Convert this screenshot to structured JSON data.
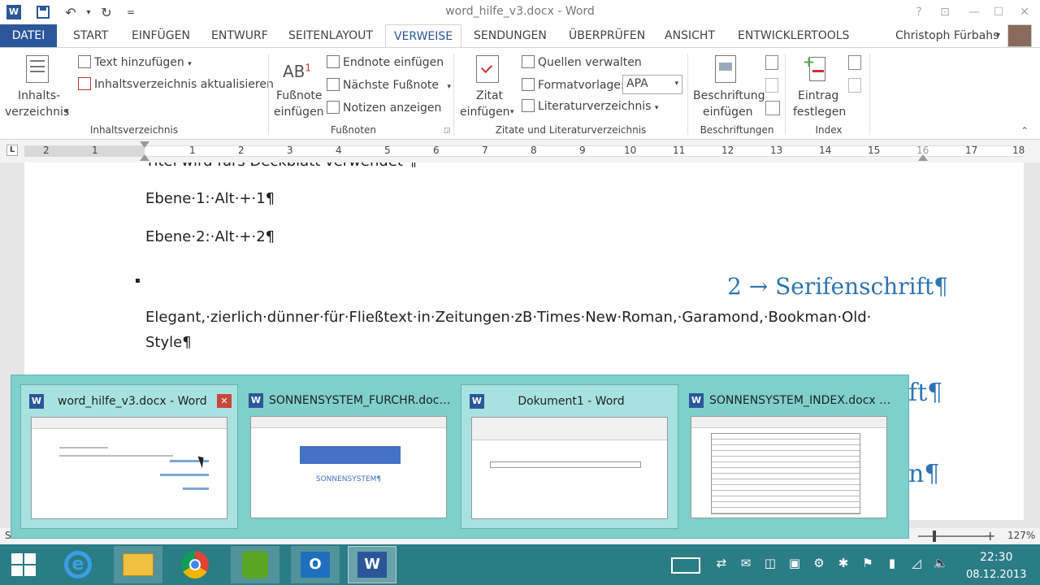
{
  "window": {
    "title": "word_hilfe_v3.docx - Word",
    "help": "?",
    "minimize": "—",
    "maximize": "☐",
    "close": "✕"
  },
  "qat": {
    "word_icon": "W",
    "save": "💾",
    "undo": "↶",
    "redo": "↻",
    "customize": "="
  },
  "tabs": [
    "DATEI",
    "START",
    "EINFÜGEN",
    "ENTWURF",
    "SEITENLAYOUT",
    "VERWEISE",
    "SENDUNGEN",
    "ÜBERPRÜFEN",
    "ANSICHT",
    "ENTWICKLERTOOLS"
  ],
  "user": {
    "name": "Christoph Fürbahs"
  },
  "ribbon": {
    "toc": {
      "button": "Inhalts-",
      "button2": "verzeichnis",
      "add_text": "Text hinzufügen",
      "update": "Inhaltsverzeichnis aktualisieren",
      "group": "Inhaltsverzeichnis"
    },
    "footnotes": {
      "icon": "AB",
      "button": "Fußnote",
      "button2": "einfügen",
      "endnote": "Endnote einfügen",
      "next": "Nächste Fußnote",
      "notes": "Notizen anzeigen",
      "group": "Fußnoten"
    },
    "citations": {
      "button": "Zitat",
      "button2": "einfügen",
      "manage": "Quellen verwalten",
      "style_label": "Formatvorlage:",
      "style_value": "APA",
      "bibliography": "Literaturverzeichnis",
      "group": "Zitate und Literaturverzeichnis"
    },
    "captions": {
      "button": "Beschriftung",
      "button2": "einfügen",
      "group": "Beschriftungen"
    },
    "index": {
      "button": "Eintrag",
      "button2": "festlegen",
      "group": "Index"
    }
  },
  "ruler": {
    "corner": "L",
    "numbers": [
      "2",
      "1",
      "1",
      "2",
      "3",
      "4",
      "5",
      "6",
      "7",
      "8",
      "9",
      "10",
      "11",
      "12",
      "13",
      "14",
      "15",
      "16",
      "17",
      "18"
    ]
  },
  "document": {
    "line0": "Titel·wird·fürs·Deckblatt·verwendet·¶",
    "line1": "Ebene·1:·Alt·+·1¶",
    "line2": "Ebene·2:·Alt·+·2¶",
    "bullet": "▪",
    "heading1": "2 → Serifenschrift¶",
    "para1a": "Elegant,·zierlich·dünner·für·Fließtext·in·Zeitungen·zB·Times·New·Roman,·Garamond,·Bookman·Old·",
    "para1b": "Style¶",
    "heading_behind1": "ft¶",
    "heading_behind2": "n¶"
  },
  "previews": [
    {
      "title": "word_hilfe_v3.docx - Word",
      "close": "✕"
    },
    {
      "title": "SONNENSYSTEM_FURCHR.docx ...",
      "thumb_text": "SONNENSYSTEM¶"
    },
    {
      "title": "Dokument1 - Word"
    },
    {
      "title": "SONNENSYSTEM_INDEX.docx - ..."
    }
  ],
  "statusbar": {
    "left": "S",
    "zoom": "127%",
    "zoom_plus": "+"
  },
  "taskbar": {
    "time": "22:30",
    "date": "08.12.2013"
  },
  "colors": {
    "word_blue": "#2b579a",
    "heading_blue": "#2e74b5",
    "taskbar": "#2a7c85",
    "preview_bg": "#7fcfcc"
  }
}
